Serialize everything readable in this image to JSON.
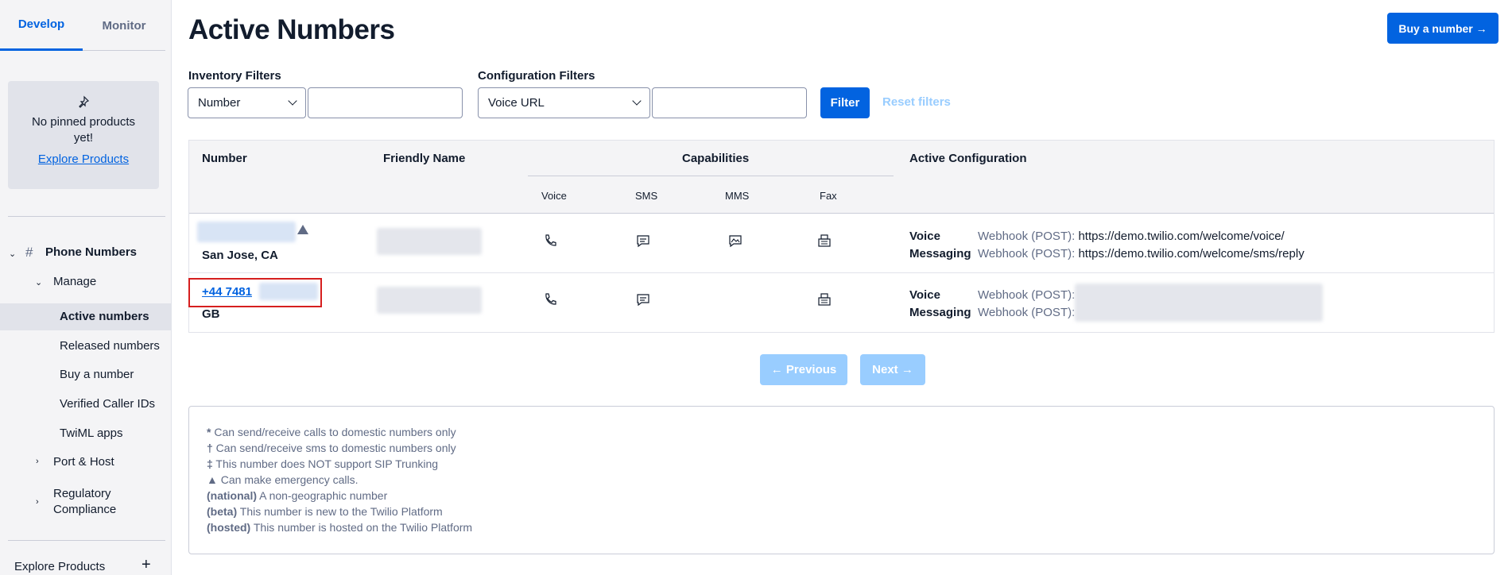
{
  "sidebar": {
    "tabs": [
      {
        "label": "Develop",
        "active": true
      },
      {
        "label": "Monitor",
        "active": false
      }
    ],
    "pinned": {
      "message": "No pinned products yet!",
      "link": "Explore Products"
    },
    "nav": {
      "section": "Phone Numbers",
      "manage": "Manage",
      "items": [
        "Active numbers",
        "Released numbers",
        "Buy a number",
        "Verified Caller IDs",
        "TwiML apps"
      ],
      "port_host": "Port & Host",
      "regulatory": "Regulatory Compliance"
    },
    "explore_products": "Explore Products",
    "plus": "+",
    "hash": "#"
  },
  "header": {
    "title": "Active Numbers",
    "buy_button": "Buy a number →"
  },
  "filters": {
    "inventory_label": "Inventory Filters",
    "inventory_select": "Number",
    "configuration_label": "Configuration Filters",
    "configuration_select": "Voice URL",
    "filter_button": "Filter",
    "reset_link": "Reset filters"
  },
  "table": {
    "headers": {
      "number": "Number",
      "friendly_name": "Friendly Name",
      "capabilities": "Capabilities",
      "active_configuration": "Active Configuration"
    },
    "capability_headers": [
      "Voice",
      "SMS",
      "MMS",
      "Fax"
    ],
    "rows": [
      {
        "number": "",
        "location": "San Jose, CA",
        "capabilities": {
          "voice": true,
          "sms": true,
          "mms": true,
          "fax": true
        },
        "voice_label": "Voice",
        "voice_method": "Webhook (POST):",
        "voice_url": "https://demo.twilio.com/welcome/voice/",
        "messaging_label": "Messaging",
        "messaging_method": "Webhook (POST):",
        "messaging_url": "https://demo.twilio.com/welcome/sms/reply"
      },
      {
        "number": "+44 7481",
        "location": "GB",
        "capabilities": {
          "voice": true,
          "sms": true,
          "mms": false,
          "fax": true
        },
        "voice_label": "Voice",
        "voice_method": "Webhook (POST):",
        "voice_url": "",
        "messaging_label": "Messaging",
        "messaging_method": "Webhook (POST):",
        "messaging_url": ""
      }
    ]
  },
  "pagination": {
    "previous": "← Previous",
    "next": "Next →"
  },
  "legend": [
    {
      "symbol": "*",
      "text": " Can send/receive calls to domestic numbers only"
    },
    {
      "symbol": "†",
      "text": " Can send/receive sms to domestic numbers only"
    },
    {
      "symbol": "‡",
      "text": " This number does NOT support SIP Trunking"
    },
    {
      "symbol": "▲",
      "text": " Can make emergency calls."
    },
    {
      "symbol": "(national)",
      "text": " A non-geographic number"
    },
    {
      "symbol": "(beta)",
      "text": " This number is new to the Twilio Platform"
    },
    {
      "symbol": "(hosted)",
      "text": " This number is hosted on the Twilio Platform"
    }
  ],
  "colors": {
    "accent": "#0263e0",
    "accent_light": "#99cdff",
    "highlight": "#d61f1f"
  }
}
